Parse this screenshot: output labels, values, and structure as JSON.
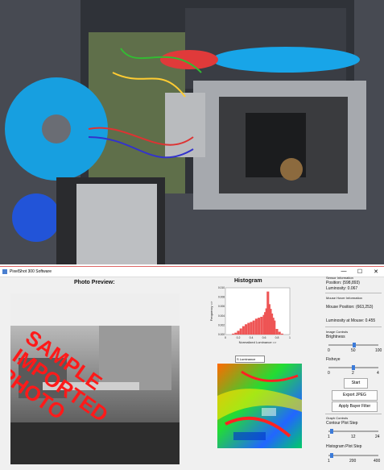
{
  "window": {
    "title": "PixelShot 300 Software",
    "controls": [
      "—",
      "☐",
      "✕"
    ]
  },
  "preview": {
    "heading": "Photo Preview:",
    "watermark": [
      "SAMPLE",
      "IMPORTED",
      "PHOTO"
    ]
  },
  "histogram": {
    "heading": "Histogram",
    "chart_data": {
      "type": "bar",
      "xlabel": "Normalized Luminance =>",
      "ylabel": "Frequency =>",
      "xticks": [
        "0",
        "0.2",
        "0.4",
        "0.6",
        "0.8",
        "1"
      ],
      "yticks": [
        "0.000",
        "0.002",
        "0.004",
        "0.006",
        "0.008",
        "0.010"
      ],
      "xlim": [
        0,
        1
      ],
      "ylim": [
        0,
        0.01
      ],
      "bins_x": [
        0.12,
        0.16,
        0.2,
        0.24,
        0.28,
        0.32,
        0.36,
        0.4,
        0.44,
        0.48,
        0.52,
        0.56,
        0.6,
        0.62,
        0.64,
        0.66,
        0.68,
        0.7,
        0.72,
        0.74,
        0.76,
        0.8,
        0.84,
        0.88
      ],
      "bins_y": [
        0.0002,
        0.0004,
        0.0008,
        0.0013,
        0.0018,
        0.0022,
        0.0025,
        0.0027,
        0.003,
        0.0034,
        0.0036,
        0.0038,
        0.0042,
        0.0048,
        0.0056,
        0.0092,
        0.0065,
        0.0055,
        0.0045,
        0.0036,
        0.003,
        0.0012,
        0.0006,
        0.0002
      ]
    },
    "select_value": "S Luminance"
  },
  "sensor": {
    "group_title": "Sensor Information",
    "position_text": "Position: (598,893)",
    "luminosity_text": "Luminosity: 0.067"
  },
  "mouse": {
    "group_title": "Mouse Hover Information",
    "position_text": "Mouse Position: (663,253)",
    "luminosity_text": "Luminosity at Mouse: 0.455"
  },
  "image_controls": {
    "group_title": "Image Controls",
    "brightness_label": "Brightness",
    "brightness_ticks": [
      "0",
      "50",
      "100"
    ],
    "brightness_value": 0.52,
    "fisheye_label": "Fisheye",
    "fisheye_ticks": [
      "0",
      "2",
      "4"
    ],
    "fisheye_value": 0.5,
    "start_label": "Start",
    "export_label": "Export JPEG",
    "bayer_label": "Apply Bayer Filter"
  },
  "graph_controls": {
    "group_title": "Graph Controls",
    "contour_label": "Contour Plot Step",
    "contour_ticks": [
      "1",
      "12",
      "24"
    ],
    "contour_value": 0.03,
    "histogram_label": "Histogram Plot Step",
    "histogram_ticks": [
      "1",
      "200",
      "400"
    ],
    "histogram_value": 0.03
  },
  "colors": {
    "histogram_bar": "#ee5555",
    "accent": "#3c7bd9",
    "watermark": "#ff1a1a"
  }
}
